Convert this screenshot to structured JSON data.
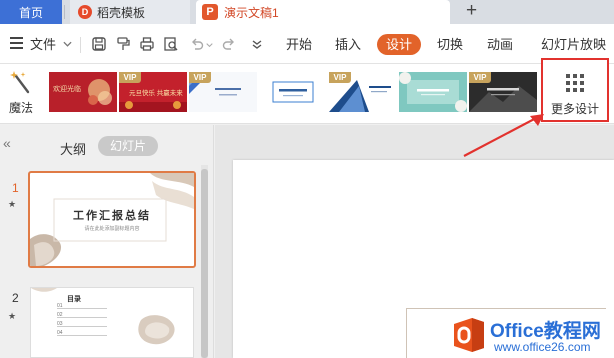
{
  "tabs": {
    "home": "首页",
    "template": "稻壳模板",
    "template_icon_glyph": "D",
    "document": "演示文稿1",
    "document_icon_glyph": "P",
    "close_glyph": "✕",
    "add_glyph": "+"
  },
  "toolbar": {
    "file_label": "文件",
    "tabs": [
      "开始",
      "插入",
      "设计",
      "切换",
      "动画",
      "幻灯片放映"
    ],
    "active_tab": "设计"
  },
  "ribbon": {
    "magic_label": "魔法",
    "vip_badge": "VIP",
    "templates": [
      {
        "title": "欢迎光临",
        "vip": false,
        "theme": "red"
      },
      {
        "title": "元旦快乐 共赢未来",
        "vip": true,
        "theme": "red"
      },
      {
        "title": "",
        "vip": true,
        "theme": "blue-white"
      },
      {
        "title": "",
        "vip": false,
        "theme": "blue-line"
      },
      {
        "title": "",
        "vip": true,
        "theme": "blue-geometric"
      },
      {
        "title": "",
        "vip": false,
        "theme": "teal-floral"
      },
      {
        "title": "",
        "vip": true,
        "theme": "dark"
      }
    ],
    "more_label": "更多设计"
  },
  "sidebar": {
    "collapse_glyph": "«",
    "outline_label": "大纲",
    "slides_label": "幻灯片",
    "star_glyph": "★",
    "slides": [
      {
        "number": "1",
        "title": "工作汇报总结",
        "subtitle": "请在此处添加副标题内容"
      },
      {
        "number": "2",
        "title": "目录",
        "items": [
          "01",
          "02",
          "03",
          "04"
        ]
      }
    ]
  },
  "watermark": {
    "line1": "Office教程网",
    "line2": "www.office26.com"
  },
  "colors": {
    "accent": "#e2632a",
    "home_tab": "#3d70d6",
    "highlight_box": "#e2322e",
    "vip_gold": "#c7a35c"
  }
}
